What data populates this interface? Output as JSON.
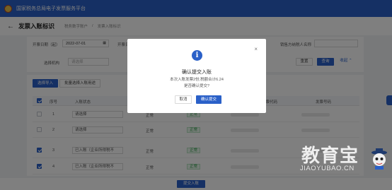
{
  "app": {
    "title": "国家税务总局电子发票服务平台"
  },
  "header": {
    "page_title": "发票入账标识",
    "breadcrumb": [
      "税务数字账户",
      "发票入账标识"
    ]
  },
  "filters": {
    "date_label": "开票日期（起）",
    "date_value": "2022-07-01",
    "date2_label": "开票日",
    "buyer_label": "销售方纳税人名称",
    "org_label": "选择机构",
    "org_placeholder": "请选择",
    "reset_label": "重置",
    "query_label": "查询",
    "collapse_label": "收起"
  },
  "actions": {
    "import_label": "选择导入",
    "batch_label": "批量选择入账用途"
  },
  "table": {
    "headers": [
      "序号",
      "入账状态",
      "",
      "",
      "发票代码",
      "发票号码"
    ],
    "rows": [
      {
        "index": "1",
        "checked": false,
        "status": "请选择",
        "flag": "正常",
        "tag": "正常"
      },
      {
        "index": "2",
        "checked": false,
        "status": "请选择",
        "flag": "正常",
        "tag": "正常"
      },
      {
        "index": "3",
        "checked": true,
        "status": "已入账（企业所得税不",
        "flag": "正常",
        "tag": "正常"
      },
      {
        "index": "4",
        "checked": true,
        "status": "已入账（企业所得税不",
        "flag": "正常",
        "tag": "正常"
      }
    ]
  },
  "footer": {
    "submit_label": "提交入账"
  },
  "modal": {
    "icon": "info-icon",
    "title": "确认提交入账",
    "message": "本次入账发票2份,税额合计6.24",
    "confirm_question": "是否确认提交?",
    "cancel_label": "取消",
    "ok_label": "确认提交",
    "close_icon": "close-icon"
  },
  "watermark": {
    "big": "教育宝",
    "small": "JIAOYUBAO.CN"
  },
  "colors": {
    "primary": "#2a60c8",
    "success": "#2d9a46",
    "overlay": "rgba(0,0,0,0.5)"
  }
}
